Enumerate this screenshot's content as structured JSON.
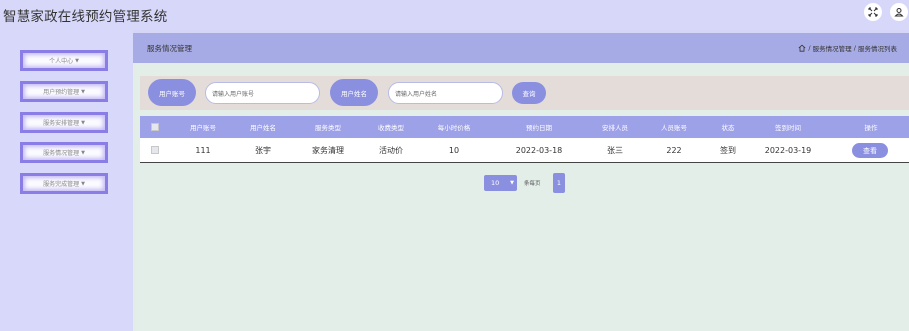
{
  "app": {
    "title": "智慧家政在线预约管理系统"
  },
  "topbar": {
    "icons": [
      "fullscreen-icon",
      "user-icon"
    ]
  },
  "sidebar": {
    "items": [
      {
        "label": "个人中心"
      },
      {
        "label": "用户预约管理"
      },
      {
        "label": "服务安排管理"
      },
      {
        "label": "服务情况管理"
      },
      {
        "label": "服务完成管理"
      }
    ]
  },
  "header": {
    "title": "服务情况管理",
    "breadcrumb": {
      "home_icon": "home-icon",
      "section": "服务情况管理",
      "separator": "/",
      "page": "服务情况列表"
    }
  },
  "search": {
    "account_label": "用户账号",
    "account_placeholder": "请输入用户账号",
    "name_label": "用户姓名",
    "name_placeholder": "请输入用户姓名",
    "query_label": "查询"
  },
  "table": {
    "headers": [
      "用户账号",
      "用户姓名",
      "服务类型",
      "收费类型",
      "每小时价格",
      "预约日期",
      "安排人员",
      "人员账号",
      "状态",
      "签到时间",
      "操作"
    ],
    "rows": [
      {
        "account": "111",
        "name": "张宇",
        "service": "家务清理",
        "charge": "活动价",
        "price": "10",
        "date": "2022-03-18",
        "staff": "张三",
        "staff_account": "222",
        "status": "签到",
        "checkin": "2022-03-19",
        "action": "查看"
      }
    ]
  },
  "pagination": {
    "page_size": "10",
    "per_page_label": "条每页",
    "current_page": "1"
  },
  "colors": {
    "accent": "#8b8fe0",
    "header_bg": "#a7abe5",
    "sidebar_bg": "#d8d9fa",
    "menu_border": "#8b7de6"
  }
}
